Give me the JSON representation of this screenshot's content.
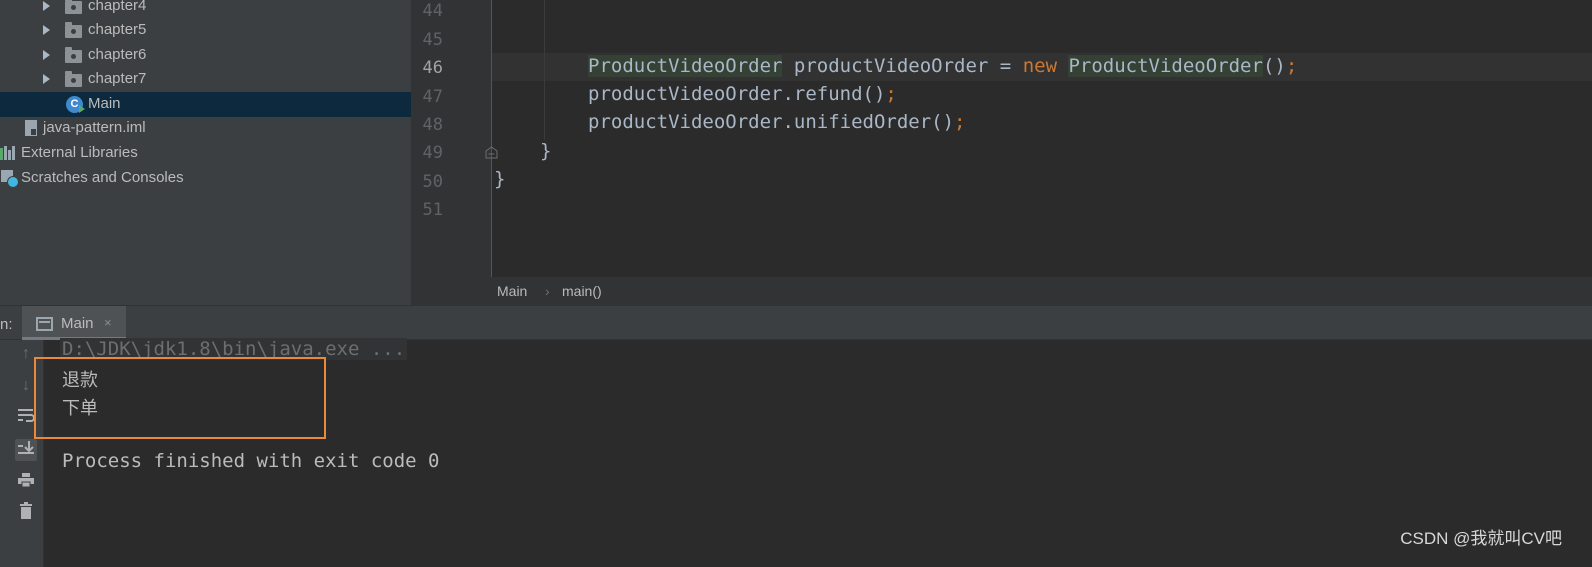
{
  "project_tree": {
    "items": [
      {
        "label": "chapter4",
        "kind": "folder"
      },
      {
        "label": "chapter5",
        "kind": "folder"
      },
      {
        "label": "chapter6",
        "kind": "folder"
      },
      {
        "label": "chapter7",
        "kind": "folder"
      },
      {
        "label": "Main",
        "kind": "class",
        "selected": true
      },
      {
        "label": "java-pattern.iml",
        "kind": "iml"
      },
      {
        "label": "External Libraries",
        "kind": "libraries"
      },
      {
        "label": "Scratches and Consoles",
        "kind": "scratches"
      }
    ]
  },
  "editor": {
    "current_line": 46,
    "lines": [
      {
        "num": "44"
      },
      {
        "num": "45"
      },
      {
        "num": "46",
        "type1": "ProductVideoOrder",
        "mid": " productVideoOrder = ",
        "kw": "new",
        "type2": "ProductVideoOrder",
        "tail": "()",
        "semi": ";"
      },
      {
        "num": "47",
        "text": "productVideoOrder.refund()",
        "semi": ";"
      },
      {
        "num": "48",
        "text": "productVideoOrder.unifiedOrder()",
        "semi": ";"
      },
      {
        "num": "49",
        "text": "}"
      },
      {
        "num": "50",
        "text": "}"
      },
      {
        "num": "51"
      }
    ],
    "breadcrumb": [
      "Main",
      "main()"
    ]
  },
  "run_panel": {
    "label": "n:",
    "tab_label": "Main",
    "tab_close": "×",
    "toolbar_icons": [
      "up-arrow-icon",
      "down-arrow-icon",
      "soft-wrap-icon",
      "scroll-to-end-icon",
      "print-icon",
      "trash-icon"
    ],
    "console": {
      "command": "D:\\JDK\\jdk1.8\\bin\\java.exe ...",
      "output": [
        "退款",
        "下单"
      ],
      "exit_message": "Process finished with exit code 0"
    }
  },
  "colors": {
    "highlight_box": "#e98a3a",
    "keyword": "#cc7832",
    "selection": "#0d293e"
  },
  "watermark": "CSDN @我就叫CV吧"
}
